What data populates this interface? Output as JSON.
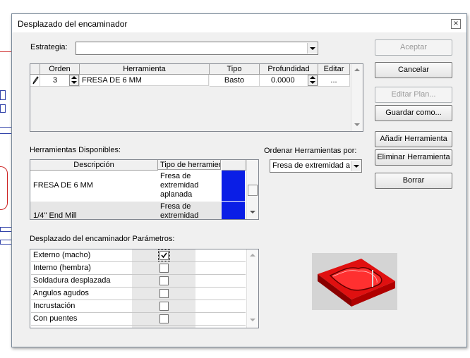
{
  "window": {
    "title": "Desplazado del encaminador"
  },
  "strategy": {
    "label": "Estrategia:",
    "value": ""
  },
  "toolpath_table": {
    "headers": [
      "Orden",
      "Herramienta",
      "Tipo",
      "Profundidad",
      "Editar"
    ],
    "rows": [
      {
        "order": "3",
        "tool": "FRESA DE 6 MM",
        "type": "Basto",
        "depth": "0.0000",
        "edit": "..."
      }
    ]
  },
  "buttons": {
    "accept": "Aceptar",
    "cancel": "Cancelar",
    "edit_plan": "Editar Plan...",
    "save_as": "Guardar como...",
    "add_tool": "Añadir Herramienta",
    "remove_tool": "Eliminar Herramienta",
    "clear": "Borrar"
  },
  "available_tools": {
    "label": "Herramientas Disponibles:",
    "headers": [
      "Descripción",
      "Tipo de herramier"
    ],
    "rows": [
      {
        "description": "FRESA DE 6 MM",
        "type_lines": [
          "Fresa de",
          "extremidad",
          "aplanada"
        ],
        "color": "#0a1ee6"
      },
      {
        "description": "1/4'' End Mill",
        "type_lines": [
          "Fresa de",
          "extremidad"
        ],
        "color": "#0a1ee6"
      }
    ]
  },
  "sort": {
    "label": "Ordenar Herramientas por:",
    "value": "Fresa de extremidad ap"
  },
  "params": {
    "label": "Desplazado del encaminador Parámetros:",
    "items": [
      {
        "label": "Externo (macho)",
        "checked": true
      },
      {
        "label": "Interno (hembra)",
        "checked": false
      },
      {
        "label": "Soldadura desplazada",
        "checked": false
      },
      {
        "label": "Angulos agudos",
        "checked": false
      },
      {
        "label": "Incrustación",
        "checked": false
      },
      {
        "label": "Con puentes",
        "checked": false
      }
    ]
  },
  "icons": {
    "row_edit": "pencil-icon",
    "close": "close-icon"
  }
}
